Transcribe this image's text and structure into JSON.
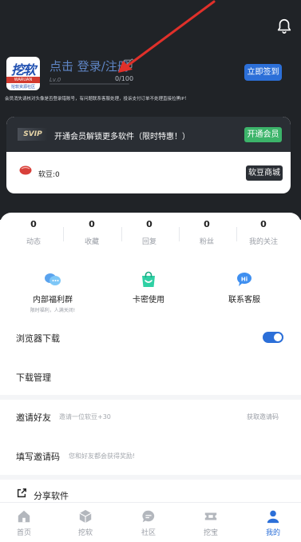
{
  "header": {
    "login_text": "点击 登录/注册",
    "level_label": "Lv.0",
    "level_progress_text": "0/100",
    "level_progress": 0,
    "signin_label": "立即签到",
    "notice": "会员消失请核对头像是否登录错账号，有问题联系客服处理，投诉支付订单不处理直接拉黑IP！",
    "logo": {
      "main": "挖软",
      "band": "WARUAN",
      "sub": "挖软资源社区"
    }
  },
  "vip": {
    "tag": "SVIP",
    "text": "开通会员解锁更多软件（限时特惠！）",
    "button": "开通会员"
  },
  "beans": {
    "text": "软豆:0",
    "shop_button": "软豆商城"
  },
  "stats": [
    {
      "value": "0",
      "label": "动态"
    },
    {
      "value": "0",
      "label": "收藏"
    },
    {
      "value": "0",
      "label": "回复"
    },
    {
      "value": "0",
      "label": "粉丝"
    },
    {
      "value": "0",
      "label": "我的关注"
    }
  ],
  "features": [
    {
      "title": "内部福利群",
      "subtitle": "限时福利，人满关闭!",
      "icon": "chat-bubbles-icon"
    },
    {
      "title": "卡密使用",
      "subtitle": "",
      "icon": "shopping-bag-icon"
    },
    {
      "title": "联系客服",
      "subtitle": "",
      "icon": "hi-bubble-icon"
    }
  ],
  "menu": {
    "browser_download": "浏览器下载",
    "browser_download_enabled": true,
    "download_manage": "下载管理",
    "invite_title": "邀请好友",
    "invite_sub": "邀请一位软豆+30",
    "invite_right": "获取邀请码",
    "code_title": "填写邀请码",
    "code_sub": "您和好友都会获得奖励!",
    "share": "分享软件"
  },
  "tabs": [
    {
      "label": "首页",
      "icon": "home-icon",
      "active": false
    },
    {
      "label": "挖软",
      "icon": "cube-icon",
      "active": false
    },
    {
      "label": "社区",
      "icon": "chat-icon",
      "active": false
    },
    {
      "label": "挖宝",
      "icon": "ticket-icon",
      "active": false
    },
    {
      "label": "我的",
      "icon": "user-icon",
      "active": true
    }
  ],
  "colors": {
    "accent": "#2c6fd8",
    "dark_header": "#202327",
    "vip_green": "#3cb46a",
    "login_link": "#5f86c6",
    "arrow_red": "#e0302a"
  }
}
